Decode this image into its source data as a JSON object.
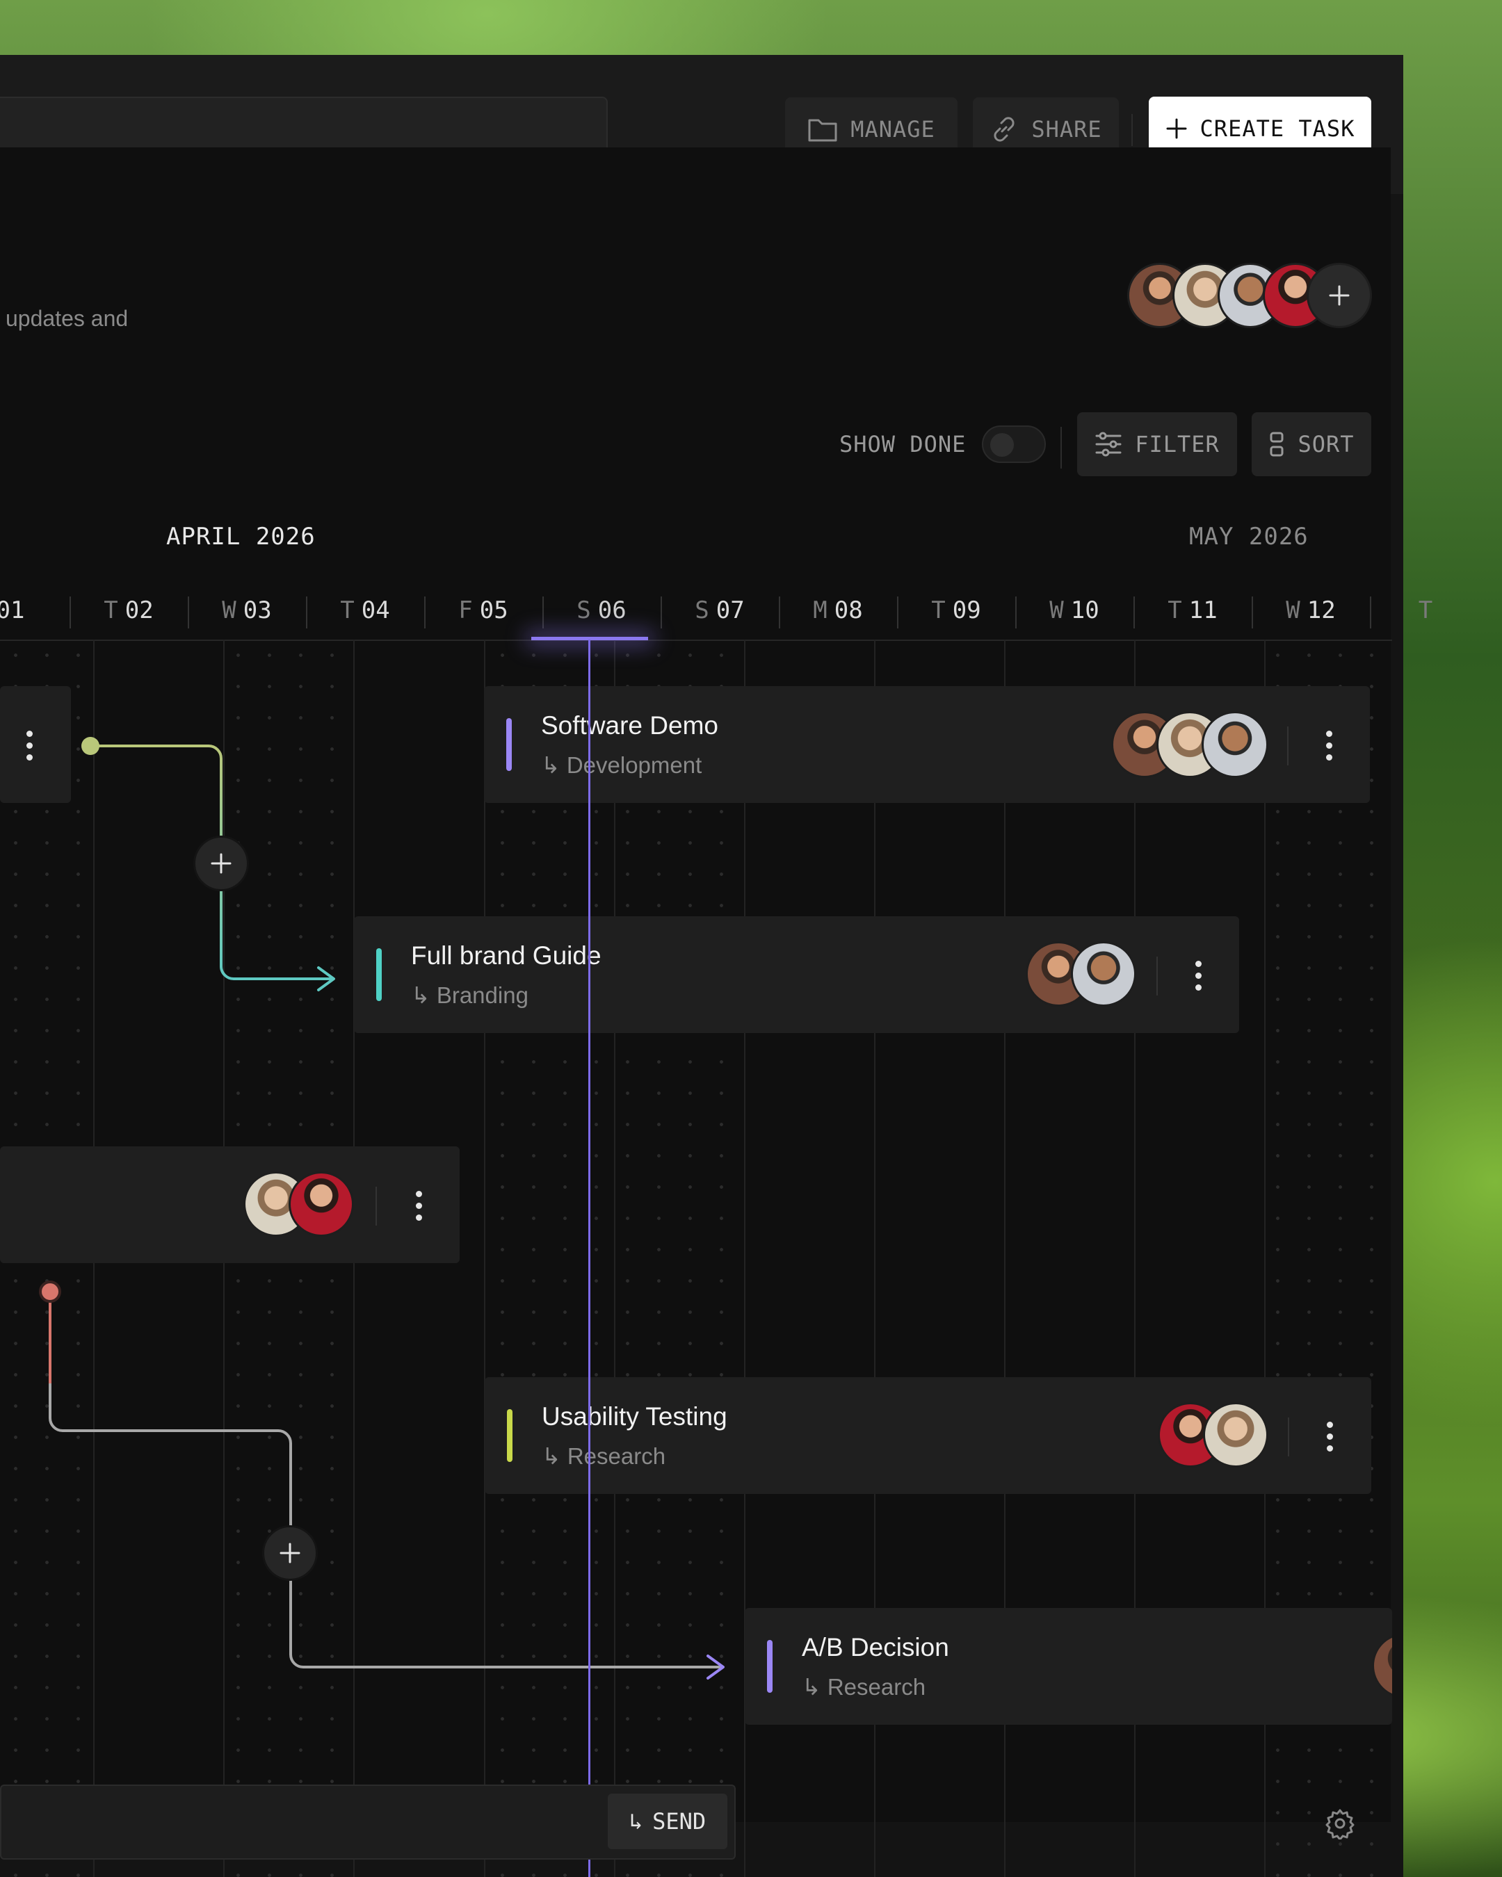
{
  "toolbar": {
    "manage_label": "MANAGE",
    "share_label": "SHARE",
    "create_label": "CREATE TASK"
  },
  "header": {
    "description_fragment": "updates and"
  },
  "controls": {
    "show_done_label": "SHOW DONE",
    "show_done_on": false,
    "filter_label": "FILTER",
    "sort_label": "SORT"
  },
  "timeline": {
    "months": [
      "APRIL 2026",
      "MAY 2026"
    ],
    "days": [
      {
        "dow": "",
        "num": "01"
      },
      {
        "dow": "T",
        "num": "02"
      },
      {
        "dow": "W",
        "num": "03"
      },
      {
        "dow": "T",
        "num": "04"
      },
      {
        "dow": "F",
        "num": "05"
      },
      {
        "dow": "S",
        "num": "06"
      },
      {
        "dow": "S",
        "num": "07"
      },
      {
        "dow": "M",
        "num": "08"
      },
      {
        "dow": "T",
        "num": "09"
      },
      {
        "dow": "W",
        "num": "10"
      },
      {
        "dow": "T",
        "num": "11"
      },
      {
        "dow": "W",
        "num": "12"
      },
      {
        "dow": "T",
        "num": ""
      }
    ],
    "today": "S 06"
  },
  "tasks": [
    {
      "title": "Software Demo",
      "subtitle": "↳ Development",
      "accent": "#9b87f5"
    },
    {
      "title": "Full brand Guide",
      "subtitle": "↳ Branding",
      "accent": "#4fd1c5"
    },
    {
      "title": "Usability Testing",
      "subtitle": "↳ Research",
      "accent": "#c9d94a"
    },
    {
      "title": "A/B Decision",
      "subtitle": "↳ Research",
      "accent": "#9b87f5"
    }
  ],
  "composer": {
    "send_label": "SEND",
    "send_arrow": "↳"
  },
  "colors": {
    "today_line": "#7d6be8",
    "connector_green": "#b9c77a",
    "connector_teal": "#5ec9c2",
    "connector_red": "#d8766c",
    "connector_purple": "#9b87f5"
  },
  "icons": [
    "folder-icon",
    "link-icon",
    "plus-icon",
    "filter-icon",
    "sort-icon",
    "gear-icon",
    "kebab-icon"
  ]
}
